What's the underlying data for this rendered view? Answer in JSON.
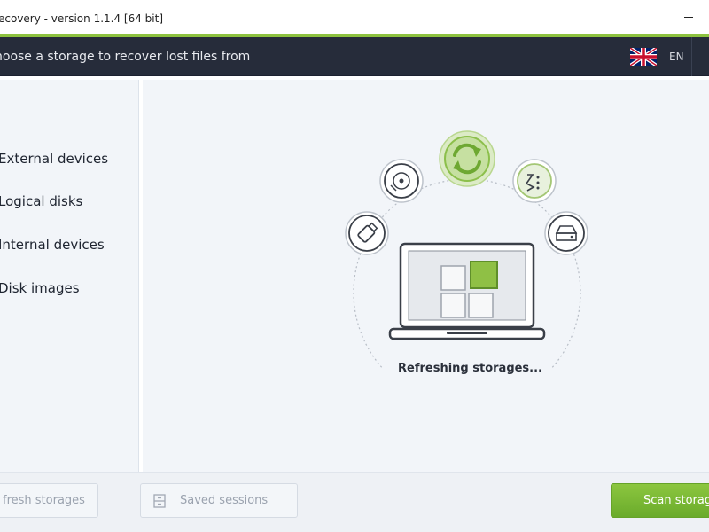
{
  "window": {
    "title": "ecovery - version 1.1.4 [64 bit]"
  },
  "header": {
    "heading": "hoose a storage to recover lost files from",
    "language_code": "EN"
  },
  "sidebar": {
    "items": [
      {
        "label": "External devices"
      },
      {
        "label": "Logical disks"
      },
      {
        "label": "Internal devices"
      },
      {
        "label": "Disk images"
      }
    ]
  },
  "main": {
    "status_text": "Refreshing storages..."
  },
  "footer": {
    "refresh_label": "fresh storages",
    "saved_sessions_label": "Saved sessions",
    "scan_label": "Scan storag"
  },
  "colors": {
    "accent": "#8dc23f",
    "header_bg": "#262c3a",
    "panel_bg": "#f2f5f9"
  }
}
